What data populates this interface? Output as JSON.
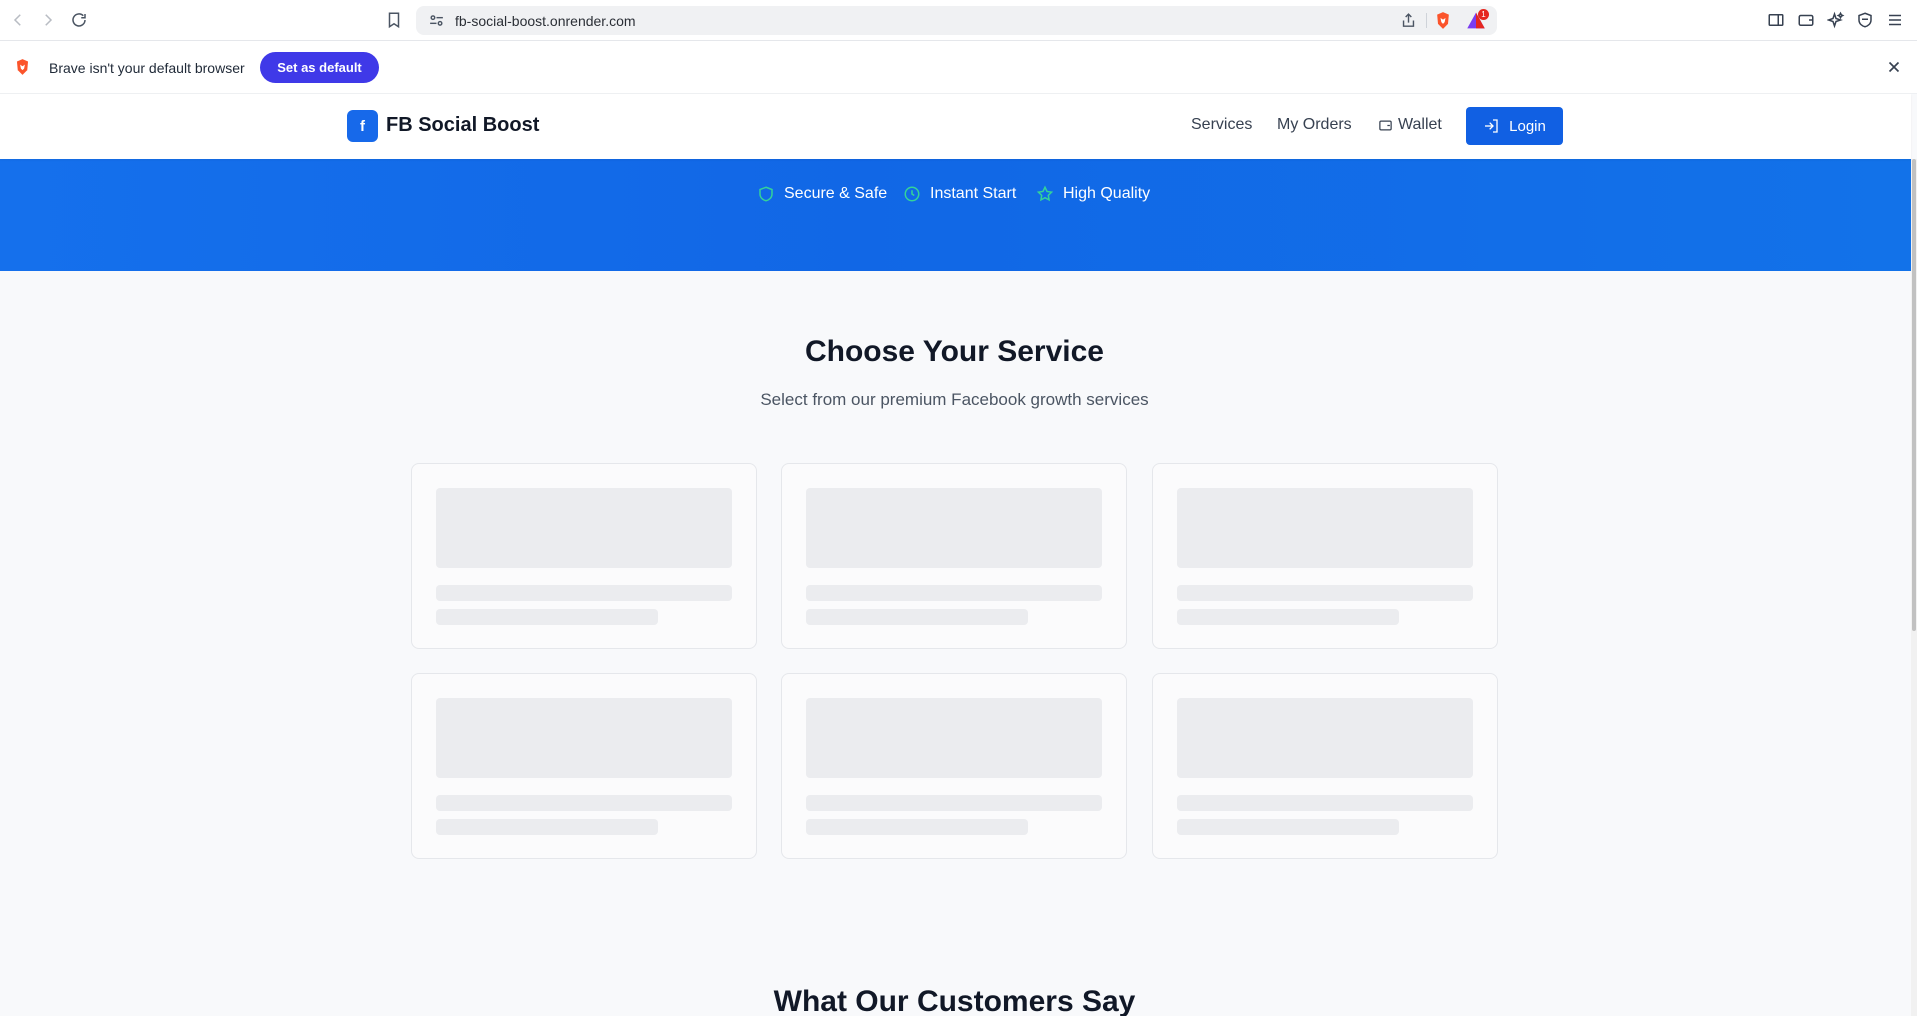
{
  "browser": {
    "url": "fb-social-boost.onrender.com",
    "rewards_badge": "1",
    "accent_brave": "#fb542b"
  },
  "infobar": {
    "message": "Brave isn't your default browser",
    "button_label": "Set as default",
    "button_color": "#3f39e8"
  },
  "header": {
    "logo_glyph": "f",
    "brand": "FB Social Boost",
    "nav": {
      "services": "Services",
      "orders": "My Orders",
      "wallet": "Wallet"
    },
    "login_label": "Login",
    "brand_color": "#1769ea"
  },
  "hero": {
    "features": [
      {
        "label": "Secure & Safe",
        "icon": "shield-icon"
      },
      {
        "label": "Instant Start",
        "icon": "clock-icon"
      },
      {
        "label": "High Quality",
        "icon": "star-icon"
      }
    ],
    "color": "#1167e6"
  },
  "main": {
    "title": "Choose Your Service",
    "subtitle": "Select from our premium Facebook growth services",
    "cards_loading": 6,
    "next_title": "What Our Customers Say"
  }
}
